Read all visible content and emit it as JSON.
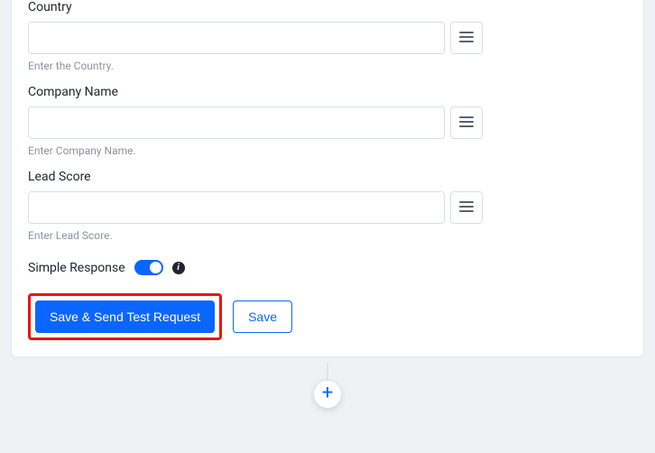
{
  "fields": {
    "country": {
      "label": "Country",
      "value": "",
      "hint": "Enter the Country."
    },
    "company": {
      "label": "Company Name",
      "value": "",
      "hint": "Enter Company Name."
    },
    "lead_score": {
      "label": "Lead Score",
      "value": "",
      "hint": "Enter Lead Score."
    }
  },
  "simple_response": {
    "label": "Simple Response",
    "enabled": true
  },
  "buttons": {
    "save_send": "Save & Send Test Request",
    "save": "Save"
  }
}
